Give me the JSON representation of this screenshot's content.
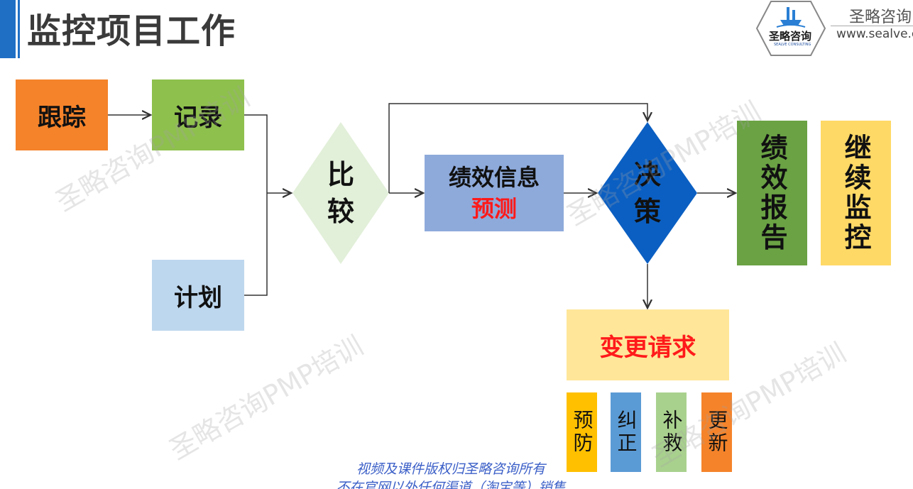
{
  "header": {
    "title": "监控项目工作",
    "brand_name": "圣略咨询",
    "brand_url": "www.sealve.c",
    "logo_text": "圣略咨询",
    "logo_sub": "SEALVE CONSULTING"
  },
  "nodes": {
    "track": "跟踪",
    "record": "记录",
    "plan": "计划",
    "compare": [
      "比",
      "较"
    ],
    "perf_info": "绩效信息",
    "forecast": "预测",
    "decide": [
      "决",
      "策"
    ],
    "perf_report": "绩效报告",
    "continue_monitor": "继续监控",
    "change_request": "变更请求",
    "preventive": "预防",
    "corrective": "纠正",
    "remedial": "补救",
    "update": "更新"
  },
  "watermark": "圣略咨询PMP培训",
  "footer": [
    "视频及课件版权归圣略咨询所有",
    "不在官网以外任何渠道（淘宝等）销售"
  ],
  "colors": {
    "accent": "#1f6fc5",
    "track": "#f5832a",
    "record": "#8ec04d",
    "plan": "#bdd7ee",
    "compare": "#e2efd9",
    "perf_info": "#8eaadb",
    "decide": "#0b5fc2",
    "perf_report": "#6aa244",
    "continue_monitor": "#ffd966",
    "change_request": "#ffe699",
    "highlight_red": "#ff1a1a"
  }
}
